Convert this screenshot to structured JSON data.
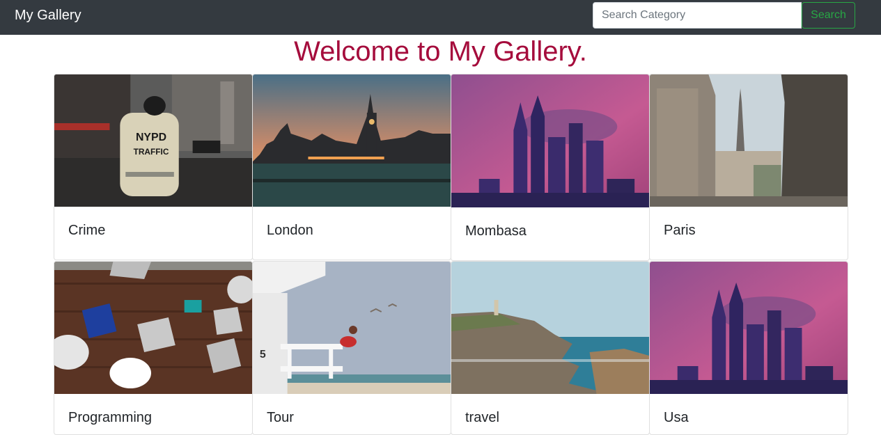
{
  "navbar": {
    "brand": "My Gallery",
    "search_placeholder": "Search Category",
    "search_button": "Search"
  },
  "page_title": "Welcome to My Gallery.",
  "cards": [
    {
      "label": "Crime",
      "image": "nypd-traffic-officer-photo"
    },
    {
      "label": "London",
      "image": "london-parliament-sunset-photo"
    },
    {
      "label": "Mombasa",
      "image": "city-skyscrapers-pink-sky-photo"
    },
    {
      "label": "Paris",
      "image": "paris-eiffel-tower-street-photo"
    },
    {
      "label": "Programming",
      "image": "team-with-laptops-photo"
    },
    {
      "label": "Tour",
      "image": "lifeguard-tower-beach-photo"
    },
    {
      "label": "travel",
      "image": "coastal-cliffs-lighthouse-photo"
    },
    {
      "label": "Usa",
      "image": "city-skyscrapers-pink-sky-photo"
    }
  ]
}
